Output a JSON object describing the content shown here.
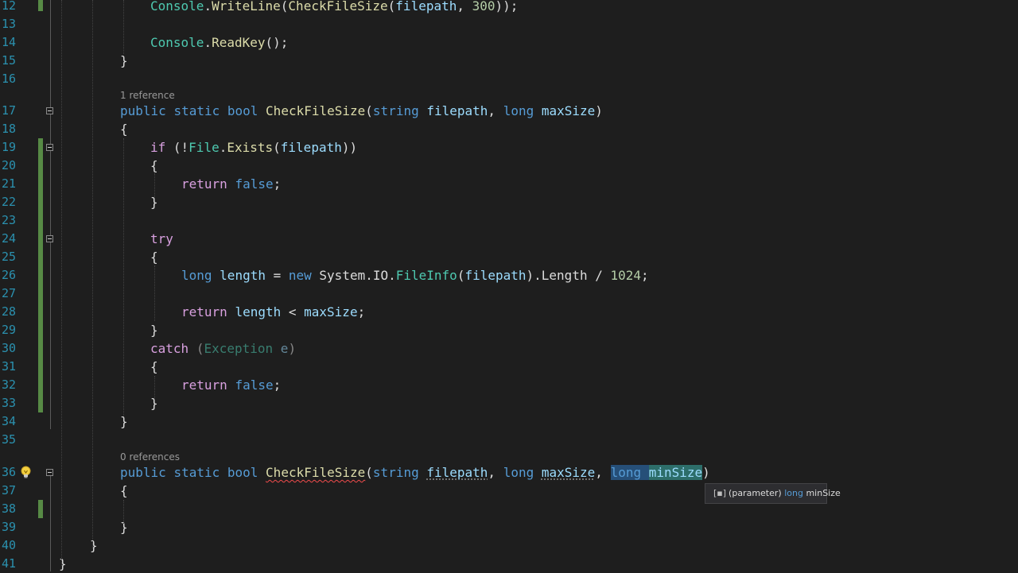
{
  "editor": {
    "code_lens": [
      "1 reference",
      "0 references"
    ],
    "lines": [
      {
        "n": "12",
        "code": "Console.WriteLine(CheckFileSize(filepath, 300));"
      },
      {
        "n": "13",
        "code": ""
      },
      {
        "n": "14",
        "code": "Console.ReadKey();"
      },
      {
        "n": "15",
        "code": "}"
      },
      {
        "n": "16",
        "code": ""
      },
      {
        "n": "17",
        "code": "public static bool CheckFileSize(string filepath, long maxSize)"
      },
      {
        "n": "18",
        "code": "{"
      },
      {
        "n": "19",
        "code": "if (!File.Exists(filepath))"
      },
      {
        "n": "20",
        "code": "{"
      },
      {
        "n": "21",
        "code": "return false;"
      },
      {
        "n": "22",
        "code": "}"
      },
      {
        "n": "23",
        "code": ""
      },
      {
        "n": "24",
        "code": "try"
      },
      {
        "n": "25",
        "code": "{"
      },
      {
        "n": "26",
        "code": "long length = new System.IO.FileInfo(filepath).Length / 1024;"
      },
      {
        "n": "27",
        "code": ""
      },
      {
        "n": "28",
        "code": "return length < maxSize;"
      },
      {
        "n": "29",
        "code": "}"
      },
      {
        "n": "30",
        "code": "catch (Exception e)"
      },
      {
        "n": "31",
        "code": "{"
      },
      {
        "n": "32",
        "code": "return false;"
      },
      {
        "n": "33",
        "code": "}"
      },
      {
        "n": "34",
        "code": "}"
      },
      {
        "n": "35",
        "code": ""
      },
      {
        "n": "36",
        "code": "public static bool CheckFileSize(string filepath, long maxSize, long minSize)"
      },
      {
        "n": "37",
        "code": "{"
      },
      {
        "n": "38",
        "code": ""
      },
      {
        "n": "39",
        "code": "}"
      },
      {
        "n": "40",
        "code": "}"
      },
      {
        "n": "41",
        "code": "}"
      }
    ]
  },
  "tooltip": {
    "icon": "parameter-icon",
    "label": "(parameter)",
    "type": "long",
    "name": "minSize"
  },
  "lightbulb": {
    "icon": "lightbulb-icon"
  },
  "colors": {
    "background": "#1e1e1e",
    "keyword": "#569cd6",
    "control": "#d8a0df",
    "type": "#4ec9b0",
    "method": "#dcdcaa",
    "parameter": "#9cdcfe",
    "number": "#b5cea8",
    "line_number": "#2b91af",
    "change_bar": "#578a45",
    "error_squiggle": "#f14c4c"
  }
}
